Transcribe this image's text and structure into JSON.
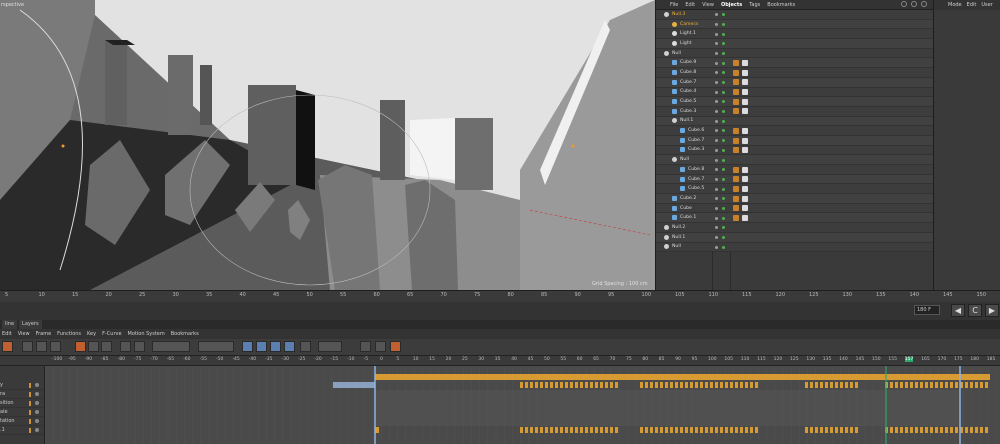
{
  "viewport": {
    "corner_label": "rspective",
    "grid_spacing_label": "Grid Spacing : 100 cm"
  },
  "object_manager": {
    "menu": [
      "File",
      "Edit",
      "View",
      "Objects",
      "Tags",
      "Bookmarks"
    ],
    "active_menu": "Objects",
    "objects": [
      {
        "name": "Null.3",
        "indent": 0,
        "highlight": true,
        "icon": "null-icon"
      },
      {
        "name": "Camera",
        "indent": 1,
        "highlight": true,
        "icon": "camera-icon"
      },
      {
        "name": "Light.1",
        "indent": 1,
        "highlight": false,
        "icon": "light-icon"
      },
      {
        "name": "Light",
        "indent": 1,
        "highlight": false,
        "icon": "light-icon"
      },
      {
        "name": "Null",
        "indent": 0,
        "highlight": false,
        "icon": "null-icon"
      },
      {
        "name": "Cube.9",
        "indent": 1,
        "highlight": false,
        "icon": "cube-icon"
      },
      {
        "name": "Cube.8",
        "indent": 1,
        "highlight": false,
        "icon": "cube-icon"
      },
      {
        "name": "Cube.7",
        "indent": 1,
        "highlight": false,
        "icon": "cube-icon"
      },
      {
        "name": "Cube.4",
        "indent": 1,
        "highlight": false,
        "icon": "cube-icon"
      },
      {
        "name": "Cube.5",
        "indent": 1,
        "highlight": false,
        "icon": "cube-icon"
      },
      {
        "name": "Cube.3",
        "indent": 1,
        "highlight": false,
        "icon": "cube-icon"
      },
      {
        "name": "Null.1",
        "indent": 1,
        "highlight": false,
        "icon": "null-icon"
      },
      {
        "name": "Cube.6",
        "indent": 2,
        "highlight": false,
        "icon": "cube-icon"
      },
      {
        "name": "Cube.7",
        "indent": 2,
        "highlight": false,
        "icon": "cube-icon"
      },
      {
        "name": "Cube.3",
        "indent": 2,
        "highlight": false,
        "icon": "cube-icon"
      },
      {
        "name": "Null",
        "indent": 1,
        "highlight": false,
        "icon": "null-icon"
      },
      {
        "name": "Cube.8",
        "indent": 2,
        "highlight": false,
        "icon": "cube-icon"
      },
      {
        "name": "Cube.7",
        "indent": 2,
        "highlight": false,
        "icon": "cube-icon"
      },
      {
        "name": "Cube.5",
        "indent": 2,
        "highlight": false,
        "icon": "cube-icon"
      },
      {
        "name": "Cube.2",
        "indent": 1,
        "highlight": false,
        "icon": "cube-icon"
      },
      {
        "name": "Cube",
        "indent": 1,
        "highlight": false,
        "icon": "cube-icon"
      },
      {
        "name": "Cube.1",
        "indent": 1,
        "highlight": false,
        "icon": "cube-icon"
      },
      {
        "name": "Null.2",
        "indent": 0,
        "highlight": false,
        "icon": "null-icon"
      },
      {
        "name": "Null.1",
        "indent": 0,
        "highlight": false,
        "icon": "null-icon"
      },
      {
        "name": "Null",
        "indent": 0,
        "highlight": false,
        "icon": "null-icon"
      }
    ]
  },
  "attributes": {
    "menu": [
      "Mode",
      "Edit",
      "User"
    ]
  },
  "timeline": {
    "ticks": [
      "5",
      "10",
      "15",
      "20",
      "25",
      "30",
      "35",
      "40",
      "45",
      "50",
      "55",
      "60",
      "65",
      "70",
      "75",
      "80",
      "85",
      "90",
      "95",
      "100",
      "105",
      "110",
      "115",
      "120",
      "125",
      "130",
      "135",
      "140",
      "145",
      "150"
    ],
    "current_frame_field": "180 F"
  },
  "dope_sheet": {
    "tabs": [
      "line",
      "Layers"
    ],
    "menu": [
      "Edit",
      "View",
      "Frame",
      "Functions",
      "Key",
      "F-Curve",
      "Motion System",
      "Bookmarks"
    ],
    "ruler_ticks": [
      "-100",
      "-95",
      "-90",
      "-85",
      "-80",
      "-75",
      "-70",
      "-65",
      "-60",
      "-55",
      "-50",
      "-45",
      "-40",
      "-35",
      "-30",
      "-25",
      "-20",
      "-15",
      "-10",
      "-5",
      "0",
      "5",
      "10",
      "15",
      "20",
      "25",
      "30",
      "35",
      "40",
      "45",
      "50",
      "55",
      "60",
      "65",
      "70",
      "75",
      "80",
      "85",
      "90",
      "95",
      "100",
      "105",
      "110",
      "115",
      "120",
      "125",
      "130",
      "135",
      "140",
      "145",
      "150",
      "155",
      "157",
      "165",
      "170",
      "175",
      "180",
      "185"
    ],
    "current_marker": "157",
    "tracks": [
      "y",
      "ra",
      "sition",
      "ale",
      "tation",
      ".1"
    ]
  },
  "colors": {
    "accent_orange": "#d89a32",
    "timeline_current": "#2fa86a"
  }
}
